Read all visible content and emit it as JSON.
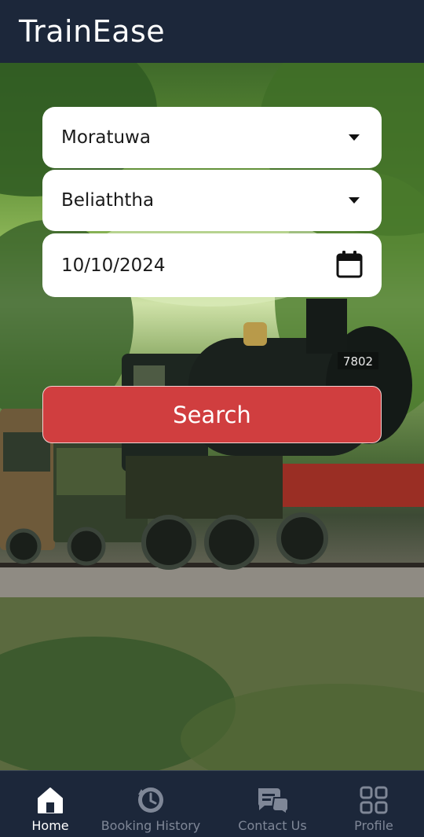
{
  "app": {
    "title": "TrainEase"
  },
  "form": {
    "from_station": "Moratuwa",
    "to_station": "Beliaththa",
    "date": "10/10/2024",
    "search_label": "Search"
  },
  "train": {
    "number_plate": "7802"
  },
  "nav": {
    "items": [
      {
        "label": "Home",
        "icon": "home-icon",
        "active": true
      },
      {
        "label": "Booking History",
        "icon": "history-icon",
        "active": false
      },
      {
        "label": "Contact Us",
        "icon": "chat-icon",
        "active": false
      },
      {
        "label": "Profile",
        "icon": "grid-icon",
        "active": false
      }
    ]
  },
  "colors": {
    "app_bar": "#1c273a",
    "search_button": "#d03e3f",
    "nav_active": "#ffffff",
    "nav_inactive": "#7f8797"
  }
}
